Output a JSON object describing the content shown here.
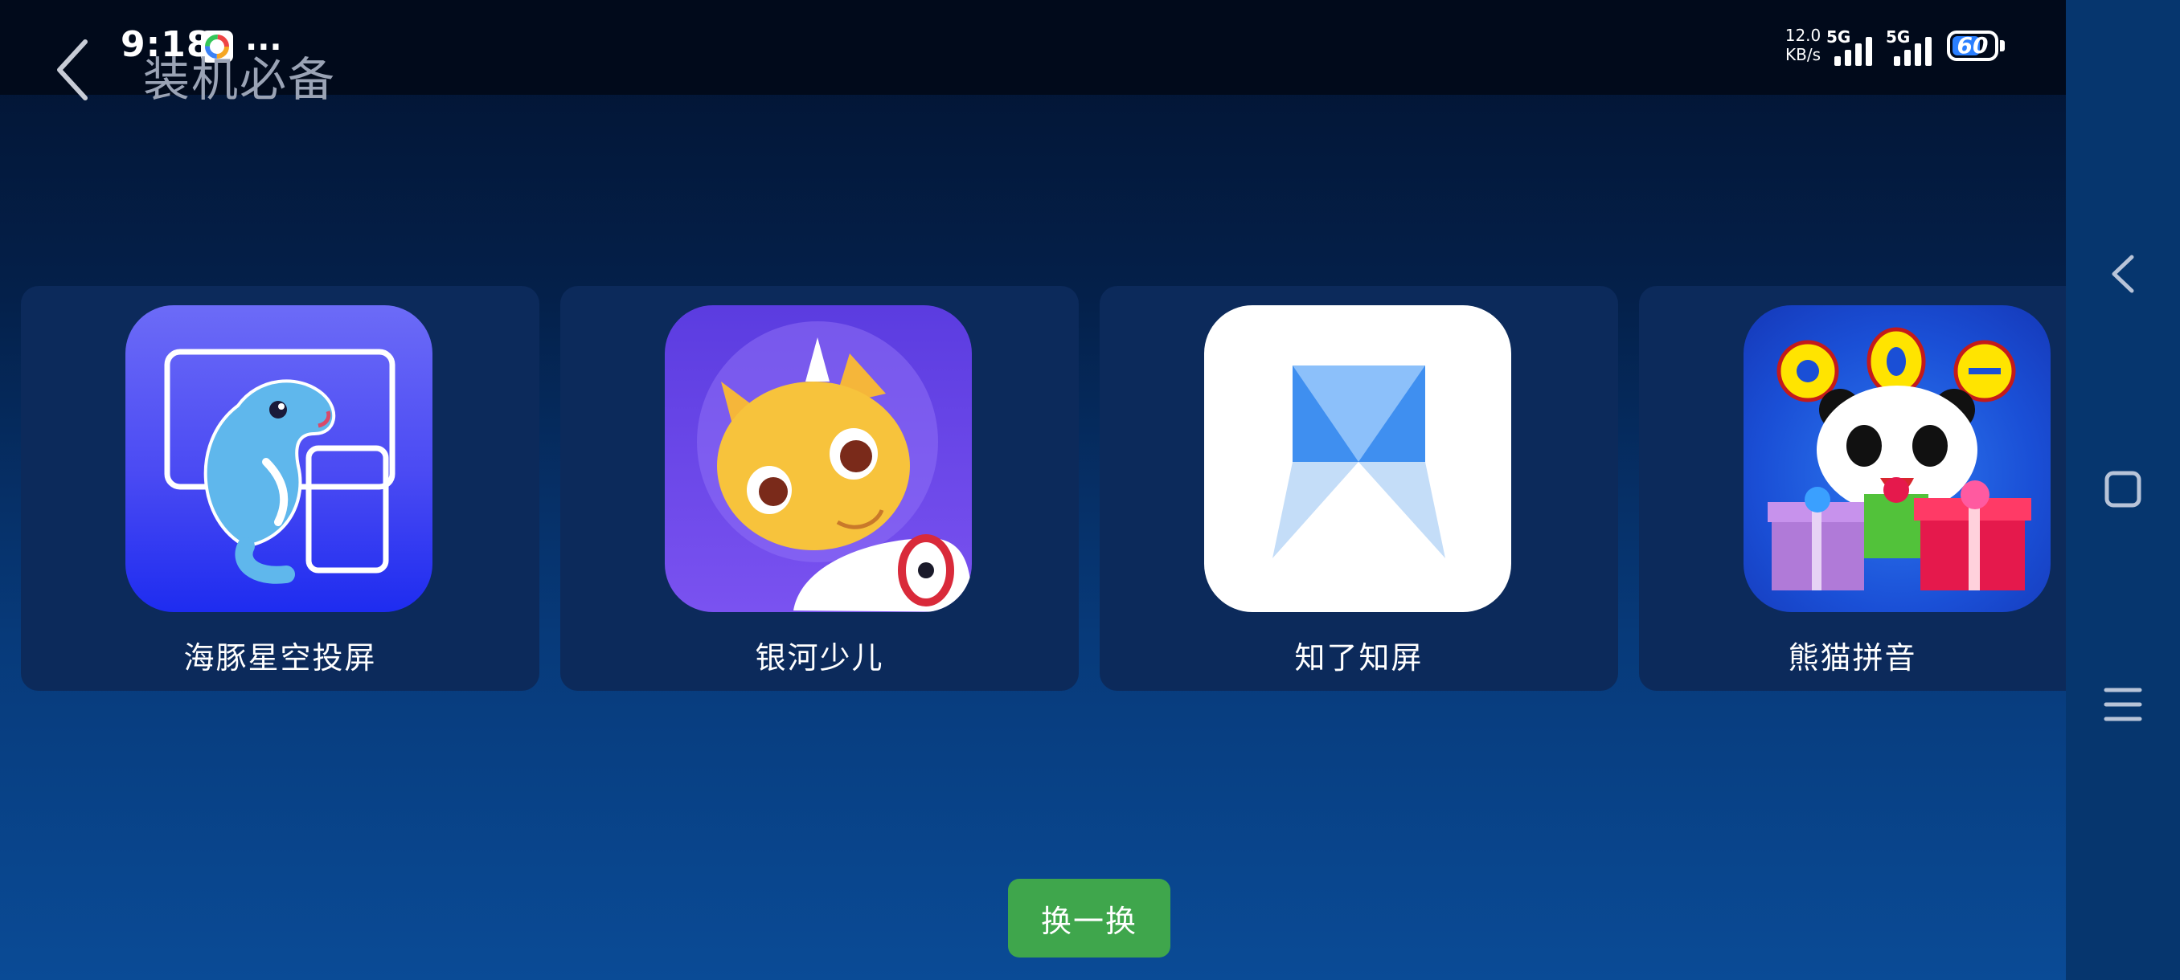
{
  "status_bar": {
    "time": "9:18",
    "more": "...",
    "net_speed_value": "12.0",
    "net_speed_unit": "KB/s",
    "sim1_label": "5G",
    "sim2_label": "5G",
    "battery_level": "60"
  },
  "header": {
    "title": "装机必备",
    "back_icon": "chevron-left-icon"
  },
  "apps": [
    {
      "name": "海豚星空投屏",
      "icon": "dolphin-icon",
      "icon_bg": "#5a57f5"
    },
    {
      "name": "银河少儿",
      "icon": "cartoon-astronaut-icon",
      "icon_bg": "#6a44e6"
    },
    {
      "name": "知了知屏",
      "icon": "blue-triangle-logo-icon",
      "icon_bg": "#ffffff"
    },
    {
      "name": "熊猫拼音",
      "icon": "panda-aoe-icon",
      "icon_bg": "#1b57d8"
    }
  ],
  "shuffle_button": {
    "label": "换一换",
    "color": "#3fa64c"
  },
  "nav_bar": {
    "back": "back-triangle-icon",
    "home": "square-home-icon",
    "menu": "menu-lines-icon"
  }
}
